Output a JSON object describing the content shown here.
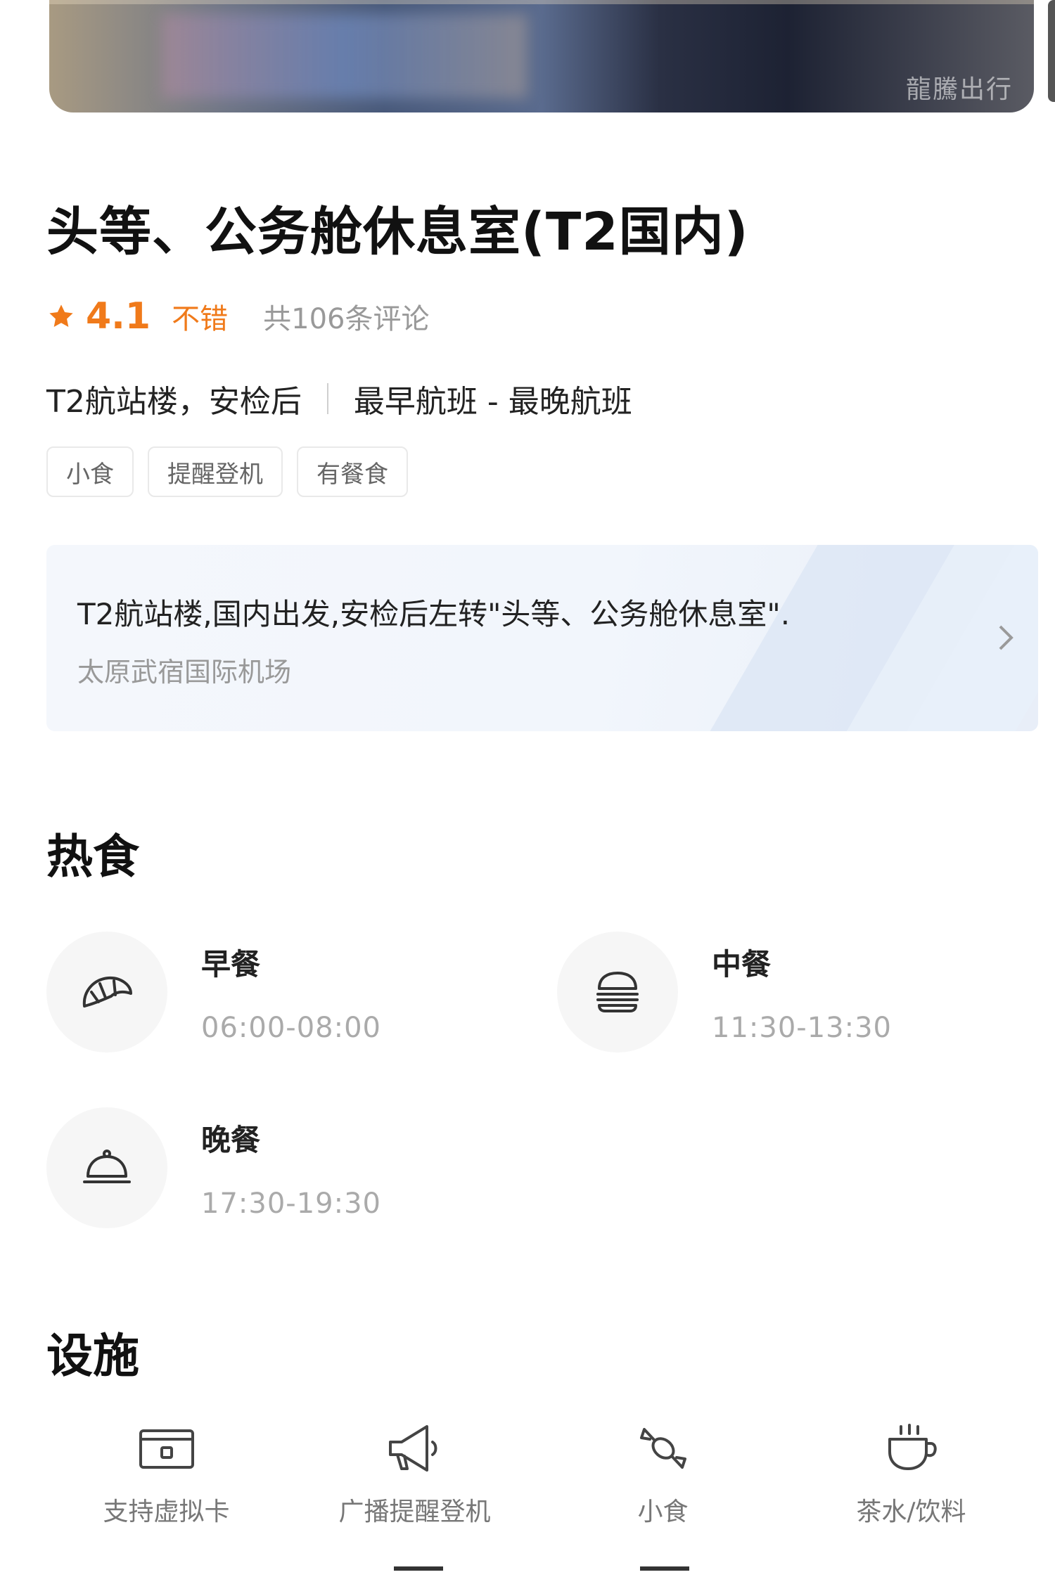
{
  "hero": {
    "watermark": "龍騰出行"
  },
  "lounge": {
    "title": "头等、公务舱休息室(T2国内)",
    "rating_score": "4.1",
    "rating_text": "不错",
    "review_count": "共106条评论",
    "location": "T2航站楼，安检后",
    "flights": "最早航班 - 最晚航班",
    "tags": [
      "小食",
      "提醒登机",
      "有餐食"
    ]
  },
  "location_card": {
    "description": "T2航站楼,国内出发,安检后左转\"头等、公务舱休息室\".",
    "airport": "太原武宿国际机场"
  },
  "hot_food": {
    "title": "热食",
    "meals": [
      {
        "name": "早餐",
        "time": "06:00-08:00",
        "icon": "croissant-icon"
      },
      {
        "name": "中餐",
        "time": "11:30-13:30",
        "icon": "burger-icon"
      },
      {
        "name": "晚餐",
        "time": "17:30-19:30",
        "icon": "cloche-icon"
      }
    ]
  },
  "facilities": {
    "title": "设施",
    "items": [
      {
        "label": "支持虚拟卡",
        "icon": "card-icon"
      },
      {
        "label": "广播提醒登机",
        "icon": "megaphone-icon"
      },
      {
        "label": "小食",
        "icon": "candy-icon"
      },
      {
        "label": "茶水/饮料",
        "icon": "cup-icon"
      }
    ]
  },
  "colors": {
    "accent": "#f07a1a",
    "text": "#1a1a1a",
    "muted": "#999999"
  }
}
